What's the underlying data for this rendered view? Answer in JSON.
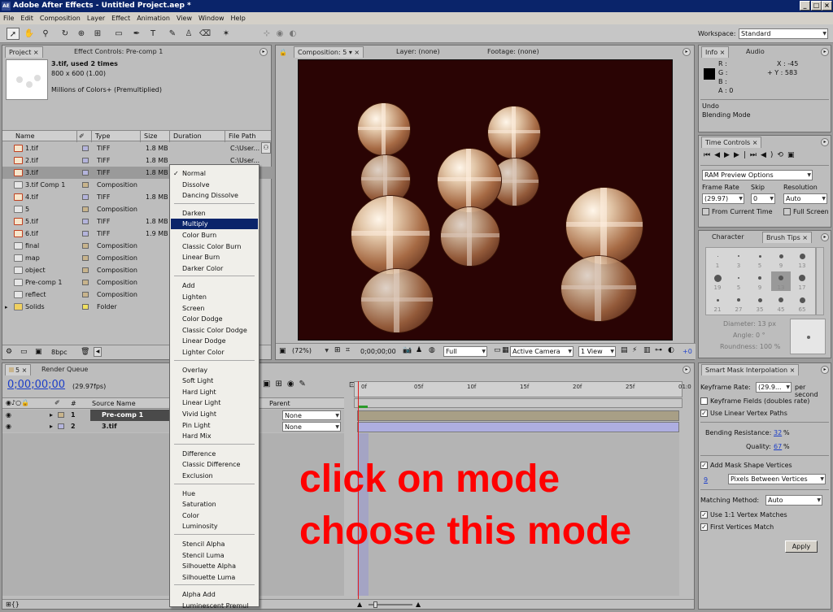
{
  "window": {
    "title": "Adobe After Effects - Untitled Project.aep *",
    "app_icon": "AE"
  },
  "menu": [
    "File",
    "Edit",
    "Composition",
    "Layer",
    "Effect",
    "Animation",
    "View",
    "Window",
    "Help"
  ],
  "workspace": {
    "label": "Workspace:",
    "value": "Standard"
  },
  "project_panel": {
    "tab_project": "Project",
    "tab_effect": "Effect Controls: Pre-comp 1",
    "item_name": "3.tif",
    "item_used": ", used 2 times",
    "item_dims": "800 x 600 (1.00)",
    "item_colors": "Millions of Colors+ (Premultiplied)",
    "columns": [
      "Name",
      "Type",
      "Size",
      "Duration",
      "File Path"
    ],
    "rows": [
      {
        "name": "1.tif",
        "type": "TIFF",
        "size": "1.8 MB",
        "path": "C:\\User...",
        "kind": "tiff",
        "label": "#b4b4dc"
      },
      {
        "name": "2.tif",
        "type": "TIFF",
        "size": "1.8 MB",
        "path": "C:\\User...",
        "kind": "tiff",
        "label": "#b4b4dc"
      },
      {
        "name": "3.tif",
        "type": "TIFF",
        "size": "1.8 MB",
        "path": "",
        "kind": "tiff",
        "label": "#b4b4dc"
      },
      {
        "name": "3.tif Comp 1",
        "type": "Composition",
        "size": "",
        "path": "",
        "kind": "comp",
        "label": "#c8b48c"
      },
      {
        "name": "4.tif",
        "type": "TIFF",
        "size": "1.8 MB",
        "path": "",
        "kind": "tiff",
        "label": "#b4b4dc"
      },
      {
        "name": "5",
        "type": "Composition",
        "size": "",
        "path": "",
        "kind": "comp",
        "label": "#c8b48c"
      },
      {
        "name": "5.tif",
        "type": "TIFF",
        "size": "1.8 MB",
        "path": "",
        "kind": "tiff",
        "label": "#b4b4dc"
      },
      {
        "name": "6.tif",
        "type": "TIFF",
        "size": "1.9 MB",
        "path": "",
        "kind": "tiff",
        "label": "#b4b4dc"
      },
      {
        "name": "final",
        "type": "Composition",
        "size": "",
        "path": "",
        "kind": "comp",
        "label": "#c8b48c"
      },
      {
        "name": "map",
        "type": "Composition",
        "size": "",
        "path": "",
        "kind": "comp",
        "label": "#c8b48c"
      },
      {
        "name": "object",
        "type": "Composition",
        "size": "",
        "path": "",
        "kind": "comp",
        "label": "#c8b48c"
      },
      {
        "name": "Pre-comp 1",
        "type": "Composition",
        "size": "",
        "path": "",
        "kind": "comp",
        "label": "#c8b48c"
      },
      {
        "name": "reflect",
        "type": "Composition",
        "size": "",
        "path": "",
        "kind": "comp",
        "label": "#c8b48c"
      },
      {
        "name": "Solids",
        "type": "Folder",
        "size": "",
        "path": "",
        "kind": "folder",
        "label": "#f0e060"
      }
    ],
    "bpc": "8bpc"
  },
  "comp_panel": {
    "tab_comp": "Composition: 5",
    "tab_layer": "Layer: (none)",
    "tab_footage": "Footage: (none)",
    "zoom": "(72%)",
    "timecode": "0;00;00;00",
    "resolution": "Full",
    "camera": "Active Camera",
    "view": "1 View",
    "offset": "+0"
  },
  "info_panel": {
    "tab_info": "Info",
    "tab_audio": "Audio",
    "r": "R :",
    "g": "G :",
    "b": "B :",
    "a": "A : 0",
    "x": "X : -45",
    "y": "+ Y : 583",
    "undo": "Undo",
    "undo_action": "Blending Mode"
  },
  "time_controls": {
    "title": "Time Controls",
    "ram_preview": "RAM Preview Options",
    "frame_rate_label": "Frame Rate",
    "skip_label": "Skip",
    "resolution_label": "Resolution",
    "frame_rate": "(29.97)",
    "skip": "0",
    "resolution": "Auto",
    "from_current": "From Current Time",
    "full_screen": "Full Screen"
  },
  "brush_panel": {
    "tab_character": "Character",
    "tab_brush": "Brush Tips",
    "sizes": [
      "1",
      "3",
      "5",
      "9",
      "13",
      "19",
      "5",
      "9",
      "13",
      "17",
      "21",
      "27",
      "35",
      "45",
      "65"
    ],
    "diameter": "Diameter: 13 px",
    "angle": "Angle: 0 °",
    "roundness": "Roundness: 100 %"
  },
  "timeline": {
    "tab_comp": "5",
    "tab_render": "Render Queue",
    "timecode": "0;00;00;00",
    "fps": "(29.97fps)",
    "col_num": "#",
    "col_source": "Source Name",
    "col_parent": "Parent",
    "layers": [
      {
        "num": "1",
        "name": "Pre-comp 1",
        "parent": "None"
      },
      {
        "num": "2",
        "name": "3.tif",
        "parent": "None"
      }
    ],
    "ruler": [
      "0f",
      "05f",
      "10f",
      "15f",
      "20f",
      "25f",
      "01:0"
    ]
  },
  "blend_menu": {
    "groups": [
      [
        "Normal",
        "Dissolve",
        "Dancing Dissolve"
      ],
      [
        "Darken",
        "Multiply",
        "Color Burn",
        "Classic Color Burn",
        "Linear Burn",
        "Darker Color"
      ],
      [
        "Add",
        "Lighten",
        "Screen",
        "Color Dodge",
        "Classic Color Dodge",
        "Linear Dodge",
        "Lighter Color"
      ],
      [
        "Overlay",
        "Soft Light",
        "Hard Light",
        "Linear Light",
        "Vivid Light",
        "Pin Light",
        "Hard Mix"
      ],
      [
        "Difference",
        "Classic Difference",
        "Exclusion"
      ],
      [
        "Hue",
        "Saturation",
        "Color",
        "Luminosity"
      ],
      [
        "Stencil Alpha",
        "Stencil Luma",
        "Silhouette Alpha",
        "Silhouette Luma"
      ],
      [
        "Alpha Add",
        "Luminescent Premul"
      ]
    ],
    "checked": "Normal",
    "highlighted": "Multiply"
  },
  "smart_mask": {
    "title": "Smart Mask Interpolation",
    "keyframe_rate_label": "Keyframe Rate:",
    "keyframe_rate": "(29.9...",
    "per_second": "per second",
    "keyframe_fields": "Keyframe Fields (doubles rate)",
    "linear_vertex": "Use Linear Vertex Paths",
    "bending_label": "Bending Resistance:",
    "bending_value": "32",
    "bending_unit": "%",
    "quality_label": "Quality:",
    "quality_value": "67",
    "quality_unit": "%",
    "add_vertices": "Add Mask Shape Vertices",
    "vertices_value": "9",
    "vertices_mode": "Pixels Between Vertices",
    "matching_label": "Matching Method:",
    "matching_value": "Auto",
    "use_11": "Use 1:1 Vertex Matches",
    "first_match": "First Vertices Match",
    "apply": "Apply"
  },
  "annotation": {
    "line1": "click on mode",
    "line2": "choose this mode"
  },
  "colors": {
    "comp_bg": "#2a0404",
    "accent": "#0a246a",
    "annotation": "#ff0000"
  }
}
